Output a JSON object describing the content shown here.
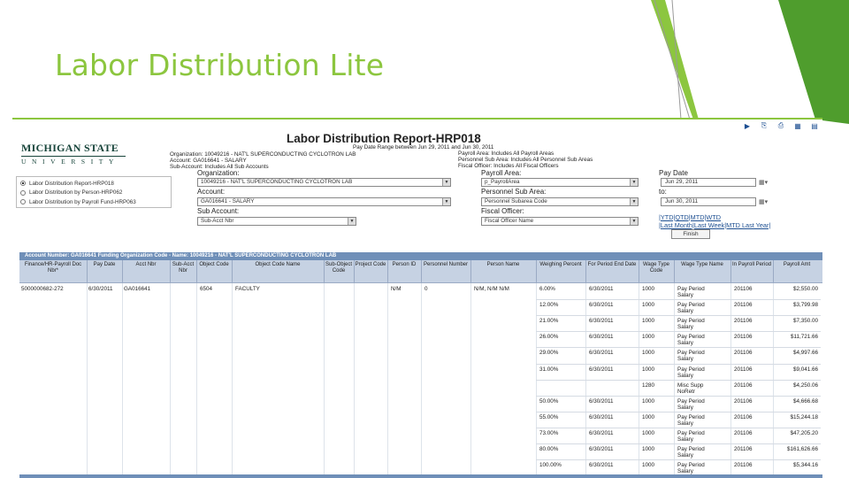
{
  "slide": {
    "title": "Labor Distribution Lite"
  },
  "toolbar": {
    "icons": [
      "play-icon",
      "export-icon",
      "print-icon",
      "excel-icon",
      "settings-icon"
    ]
  },
  "logo": {
    "top": "MICHIGAN STATE",
    "bottom": "UNIVERSITY"
  },
  "report": {
    "title": "Labor Distribution Report-HRP018",
    "info_left": [
      "Organization: 10049216 - NAT'L SUPERCONDUCTING CYCLOTRON LAB",
      "Account: GA016641 - SALARY",
      "Sub-Account: Includes All Sub Accounts"
    ],
    "info_date": "Pay Date Range between Jun 29, 2011 and Jun 30, 2011",
    "info_right": [
      "Payroll Area: Includes All Payroll Areas",
      "Personnel Sub Area: Includes All Personnel Sub Areas",
      "Fiscal Officer: Includes All Fiscal Officers"
    ]
  },
  "report_options": [
    {
      "label": "Labor Distribution Report-HRP018",
      "selected": true
    },
    {
      "label": "Labor Distribution by Person-HRP062",
      "selected": false
    },
    {
      "label": "Labor Distribution by Payroll Fund-HRP063",
      "selected": false
    }
  ],
  "filters": {
    "organization_label": "Organization:",
    "organization_value": "10049216 - NAT'L SUPERCONDUCTING CYCLOTRON LAB",
    "account_label": "Account:",
    "account_value": "GA016641 - SALARY",
    "sub_account_label": "Sub Account:",
    "sub_account_value": "Sub-Acct Nbr",
    "payroll_area_label": "Payroll Area:",
    "payroll_area_value": "p_PayrollArea",
    "personnel_sub_area_label": "Personnel Sub Area:",
    "personnel_sub_area_value": "Personnel Subarea Code",
    "fiscal_officer_label": "Fiscal Officer:",
    "fiscal_officer_value": "Fiscal Officer Name",
    "pay_date_label": "Pay Date",
    "pay_date_from": "Jun 29, 2011",
    "to_label": "to:",
    "pay_date_to": "Jun 30, 2011",
    "period_links_1": "|YTD|QTD|MTD|WTD",
    "period_links_2": "|Last Month|Last Week|MTD Last Year|",
    "finish_label": "Finish"
  },
  "grid": {
    "account_header": "Account Number: GA016641     Funding Organization Code - Name: 10049216 - NAT'L SUPERCONDUCTING CYCLOTRON LAB",
    "columns": [
      "Finance/HR-Payroll Doc Nbr*",
      "Pay Date",
      "Acct Nbr",
      "Sub-Acct Nbr",
      "Object Code",
      "Object Code Name",
      "Sub-Object Code",
      "Project Code",
      "Person ID",
      "Personnel Number",
      "Person Name",
      "Weighing Percent",
      "For Period End Date",
      "Wage Type Code",
      "Wage Type Name",
      "In Payroll Period",
      "Payroll Amt"
    ],
    "first_row": {
      "doc_nbr": "5000000682-272",
      "pay_date": "6/30/2011",
      "acct_nbr": "GA016641",
      "object_code": "6504",
      "object_code_name": "FACULTY",
      "person_id": "N/M",
      "personnel_number": "0",
      "person_name": "N/M, N/M N/M"
    },
    "rows": [
      {
        "weighing": "6.00%",
        "end_date": "6/30/2011",
        "wage_code": "1000",
        "wage_name": "Pay Period Salary",
        "period": "201106",
        "amount": "$2,550.00"
      },
      {
        "weighing": "12.00%",
        "end_date": "6/30/2011",
        "wage_code": "1000",
        "wage_name": "Pay Period Salary",
        "period": "201106",
        "amount": "$3,799.98"
      },
      {
        "weighing": "21.00%",
        "end_date": "6/30/2011",
        "wage_code": "1000",
        "wage_name": "Pay Period Salary",
        "period": "201106",
        "amount": "$7,350.00"
      },
      {
        "weighing": "26.00%",
        "end_date": "6/30/2011",
        "wage_code": "1000",
        "wage_name": "Pay Period Salary",
        "period": "201106",
        "amount": "$11,721.66"
      },
      {
        "weighing": "29.00%",
        "end_date": "6/30/2011",
        "wage_code": "1000",
        "wage_name": "Pay Period Salary",
        "period": "201106",
        "amount": "$4,997.66"
      },
      {
        "weighing": "31.00%",
        "end_date": "6/30/2011",
        "wage_code": "1000",
        "wage_name": "Pay Period Salary",
        "period": "201106",
        "amount": "$9,041.66"
      },
      {
        "weighing": "",
        "end_date": "",
        "wage_code": "1280",
        "wage_name": "Misc Supp NoRetr",
        "period": "201106",
        "amount": "$4,250.06"
      },
      {
        "weighing": "50.00%",
        "end_date": "6/30/2011",
        "wage_code": "1000",
        "wage_name": "Pay Period Salary",
        "period": "201106",
        "amount": "$4,666.68"
      },
      {
        "weighing": "55.00%",
        "end_date": "6/30/2011",
        "wage_code": "1000",
        "wage_name": "Pay Period Salary",
        "period": "201106",
        "amount": "$15,244.18"
      },
      {
        "weighing": "73.00%",
        "end_date": "6/30/2011",
        "wage_code": "1000",
        "wage_name": "Pay Period Salary",
        "period": "201106",
        "amount": "$47,205.20"
      },
      {
        "weighing": "80.00%",
        "end_date": "6/30/2011",
        "wage_code": "1000",
        "wage_name": "Pay Period Salary",
        "period": "201106",
        "amount": "$161,626.66"
      },
      {
        "weighing": "100.00%",
        "end_date": "6/30/2011",
        "wage_code": "1000",
        "wage_name": "Pay Period Salary",
        "period": "201106",
        "amount": "$5,344.16"
      }
    ]
  },
  "colors": {
    "accent": "#8cc63f",
    "accent_dark": "#4f9d2d",
    "grid_header": "#c6d2e3",
    "grid_bar": "#6f8fb8",
    "msu_green": "#18453b"
  }
}
